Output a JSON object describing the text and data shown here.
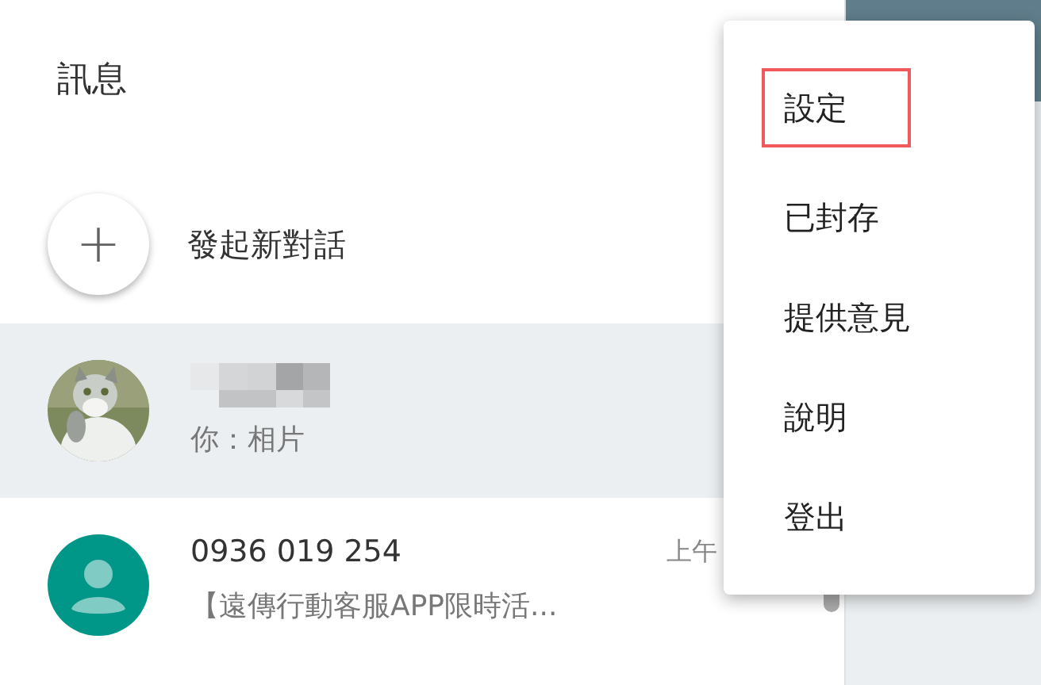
{
  "header": {
    "title": "訊息"
  },
  "new_conversation": {
    "icon": "+",
    "label": "發起新對話"
  },
  "conversations": [
    {
      "selected": true,
      "kind": "picture",
      "preview": "你：相片"
    },
    {
      "selected": false,
      "kind": "person",
      "name": "0936 019 254",
      "time": "上午",
      "preview": "【遠傳行動客服APP限時活..."
    }
  ],
  "menu": {
    "items": [
      {
        "label": "設定",
        "highlighted": true
      },
      {
        "label": "已封存",
        "highlighted": false
      },
      {
        "label": "提供意見",
        "highlighted": false
      },
      {
        "label": "說明",
        "highlighted": false
      },
      {
        "label": "登出",
        "highlighted": false
      }
    ]
  }
}
